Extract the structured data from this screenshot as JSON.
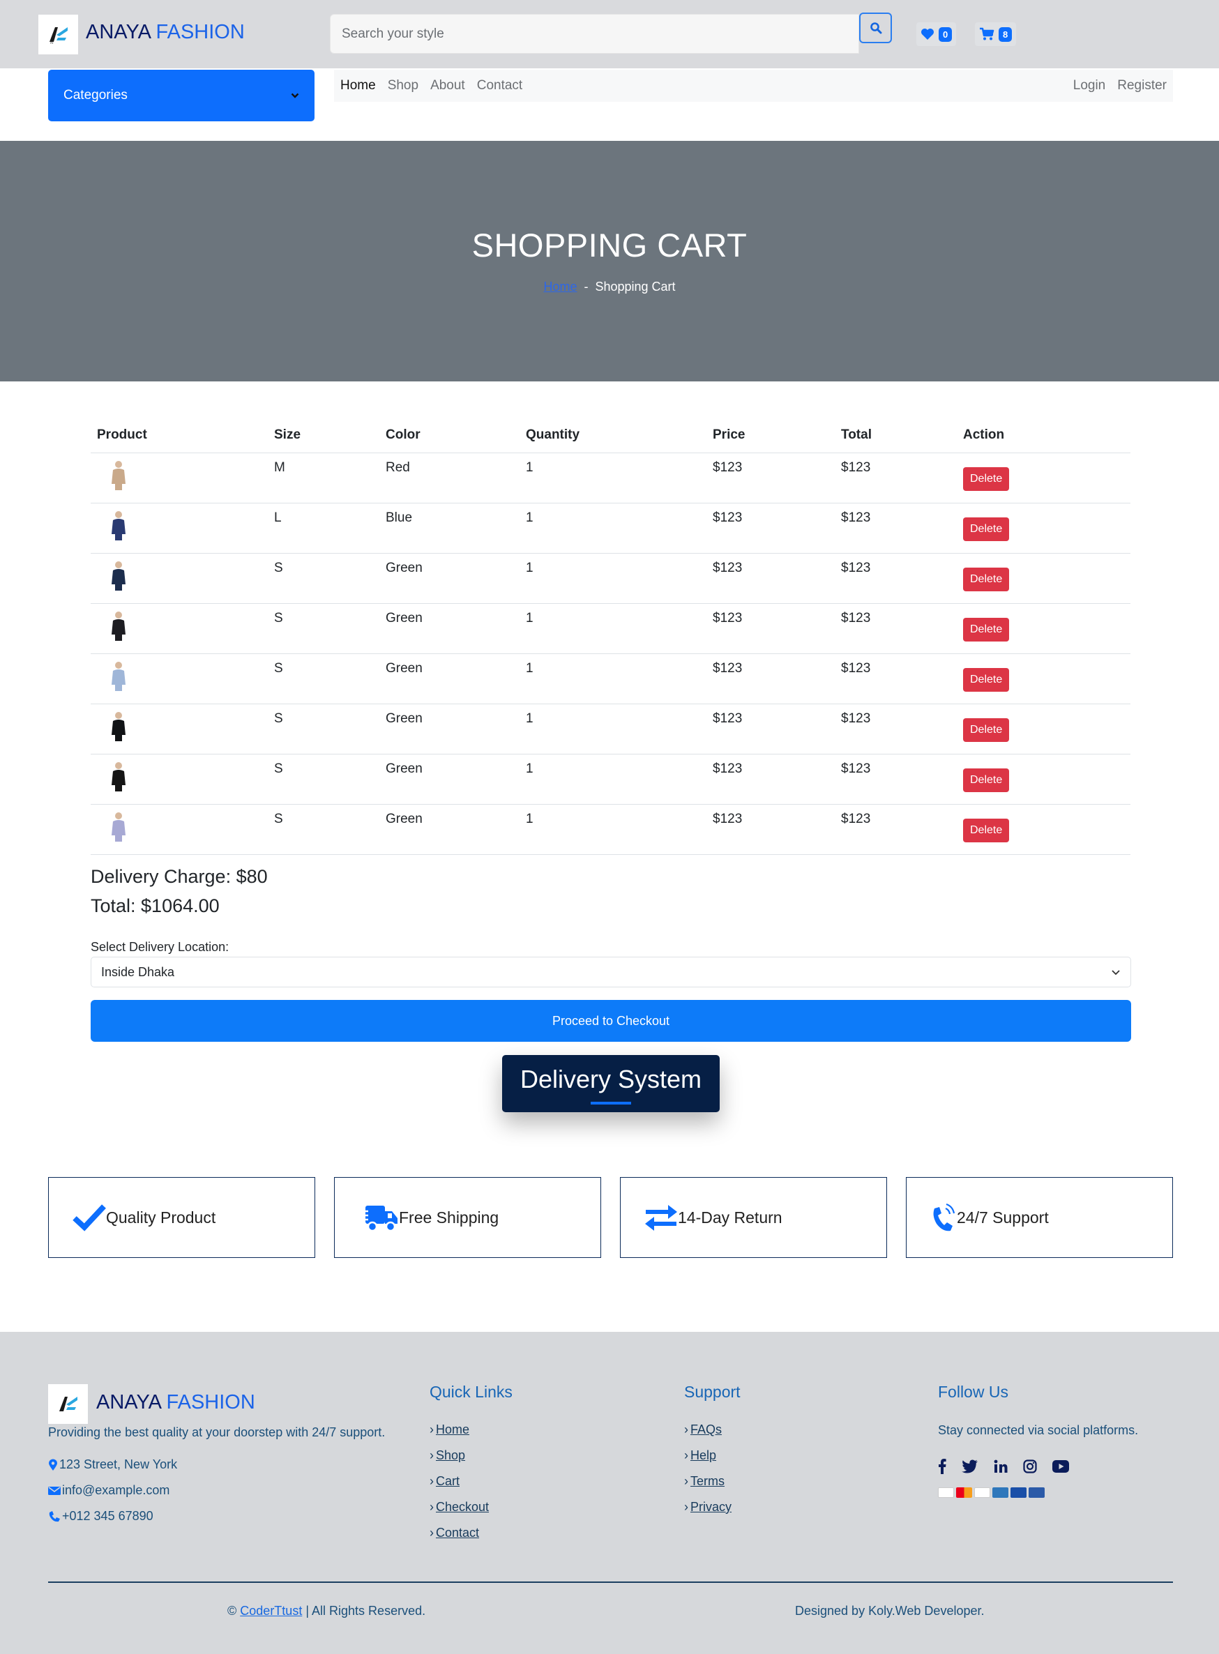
{
  "header": {
    "brand_part1": "ANAYA",
    "brand_part2": "FASHION",
    "logo_text": "AF",
    "search_placeholder": "Search your style",
    "wishlist_count": "0",
    "cart_count": "8"
  },
  "nav": {
    "categories_label": "Categories",
    "links": [
      "Home",
      "Shop",
      "About",
      "Contact"
    ],
    "auth": [
      "Login",
      "Register"
    ]
  },
  "hero": {
    "title": "SHOPPING CART",
    "breadcrumb_home": "Home",
    "breadcrumb_sep": "-",
    "breadcrumb_current": "Shopping Cart"
  },
  "cart": {
    "columns": [
      "Product",
      "Size",
      "Color",
      "Quantity",
      "Price",
      "Total",
      "Action"
    ],
    "delete_label": "Delete",
    "rows": [
      {
        "size": "M",
        "color": "Red",
        "qty": "1",
        "price": "$123",
        "total": "$123",
        "img_color": "#c9a98a"
      },
      {
        "size": "L",
        "color": "Blue",
        "qty": "1",
        "price": "$123",
        "total": "$123",
        "img_color": "#2a3a72"
      },
      {
        "size": "S",
        "color": "Green",
        "qty": "1",
        "price": "$123",
        "total": "$123",
        "img_color": "#1c2d4d"
      },
      {
        "size": "S",
        "color": "Green",
        "qty": "1",
        "price": "$123",
        "total": "$123",
        "img_color": "#1d1d22"
      },
      {
        "size": "S",
        "color": "Green",
        "qty": "1",
        "price": "$123",
        "total": "$123",
        "img_color": "#9fb6d8"
      },
      {
        "size": "S",
        "color": "Green",
        "qty": "1",
        "price": "$123",
        "total": "$123",
        "img_color": "#111316"
      },
      {
        "size": "S",
        "color": "Green",
        "qty": "1",
        "price": "$123",
        "total": "$123",
        "img_color": "#151515"
      },
      {
        "size": "S",
        "color": "Green",
        "qty": "1",
        "price": "$123",
        "total": "$123",
        "img_color": "#a7a9d4"
      }
    ],
    "delivery_charge": "Delivery Charge: $80",
    "total": "Total: $1064.00",
    "location_label": "Select Delivery Location:",
    "location_value": "Inside Dhaka",
    "checkout_label": "Proceed to Checkout"
  },
  "delivery": {
    "title": "Delivery System",
    "features": [
      "Quality Product",
      "Free Shipping",
      "14-Day Return",
      "24/7 Support"
    ]
  },
  "footer": {
    "tagline": "Providing the best quality at your doorstep with 24/7 support.",
    "address": "123 Street, New York",
    "email": "info@example.com",
    "phone": "+012 345 67890",
    "quick_links_title": "Quick Links",
    "quick_links": [
      "Home",
      "Shop",
      "Cart",
      "Checkout",
      "Contact"
    ],
    "support_title": "Support",
    "support_links": [
      "FAQs",
      "Help",
      "Terms",
      "Privacy"
    ],
    "follow_title": "Follow Us",
    "follow_text": "Stay connected via social platforms.",
    "copyright_prefix": "©",
    "copyright_link": "CoderTtust",
    "copyright_suffix": "| All Rights Reserved.",
    "designed_by": "Designed by Koly.Web Developer."
  },
  "colors": {
    "primary": "#0d6efd",
    "danger": "#dc3545",
    "hero_bg": "#6c757d",
    "navy": "#061f45"
  }
}
